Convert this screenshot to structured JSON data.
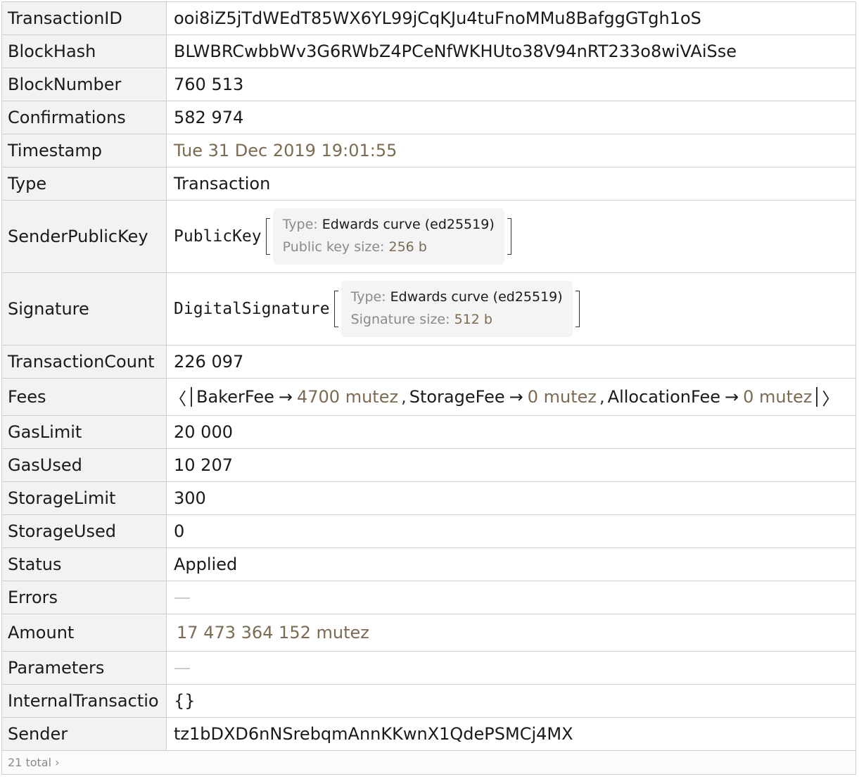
{
  "rows": {
    "transaction_id": {
      "key": "TransactionID",
      "value": "ooi8iZ5jTdWEdT85WX6YL99jCqKJu4tuFnoMMu8BafggGTgh1oS"
    },
    "block_hash": {
      "key": "BlockHash",
      "value": "BLWBRCwbbWv3G6RWbZ4PCeNfWKHUto38V94nRT233o8wiVAiSse"
    },
    "block_number": {
      "key": "BlockNumber",
      "value": "760 513"
    },
    "confirmations": {
      "key": "Confirmations",
      "value": "582 974"
    },
    "timestamp": {
      "key": "Timestamp",
      "value": "Tue 31 Dec 2019 19:01:55"
    },
    "type": {
      "key": "Type",
      "value": "Transaction"
    },
    "sender_public_key": {
      "key": "SenderPublicKey",
      "head": "PublicKey",
      "type_label": "Type:",
      "type_value": "Edwards curve (ed25519)",
      "size_label": "Public key size:",
      "size_value": "256 b"
    },
    "signature": {
      "key": "Signature",
      "head": "DigitalSignature",
      "type_label": "Type:",
      "type_value": "Edwards curve (ed25519)",
      "size_label": "Signature size:",
      "size_value": "512 b"
    },
    "transaction_count": {
      "key": "TransactionCount",
      "value": "226 097"
    },
    "fees": {
      "key": "Fees",
      "open": "〈",
      "close": "〉",
      "items": [
        {
          "name": "BakerFee",
          "arrow": "→",
          "amount": "4700 mutez",
          "sep": ","
        },
        {
          "name": "StorageFee",
          "arrow": "→",
          "amount": "0 mutez",
          "sep": ","
        },
        {
          "name": "AllocationFee",
          "arrow": "→",
          "amount": "0 mutez"
        }
      ]
    },
    "gas_limit": {
      "key": "GasLimit",
      "value": "20 000"
    },
    "gas_used": {
      "key": "GasUsed",
      "value": "10 207"
    },
    "storage_limit": {
      "key": "StorageLimit",
      "value": "300"
    },
    "storage_used": {
      "key": "StorageUsed",
      "value": "0"
    },
    "status": {
      "key": "Status",
      "value": "Applied"
    },
    "errors": {
      "key": "Errors",
      "value": "—"
    },
    "amount": {
      "key": "Amount",
      "value": "17 473 364 152 mutez"
    },
    "parameters": {
      "key": "Parameters",
      "value": "—"
    },
    "internal_transactions": {
      "key": "InternalTransactio",
      "value": "{}"
    },
    "sender": {
      "key": "Sender",
      "value": "tz1bDXD6nNSrebqmAnnKKwnX1QdePSMCj4MX"
    }
  },
  "footer": {
    "total_text": "21 total ›"
  }
}
